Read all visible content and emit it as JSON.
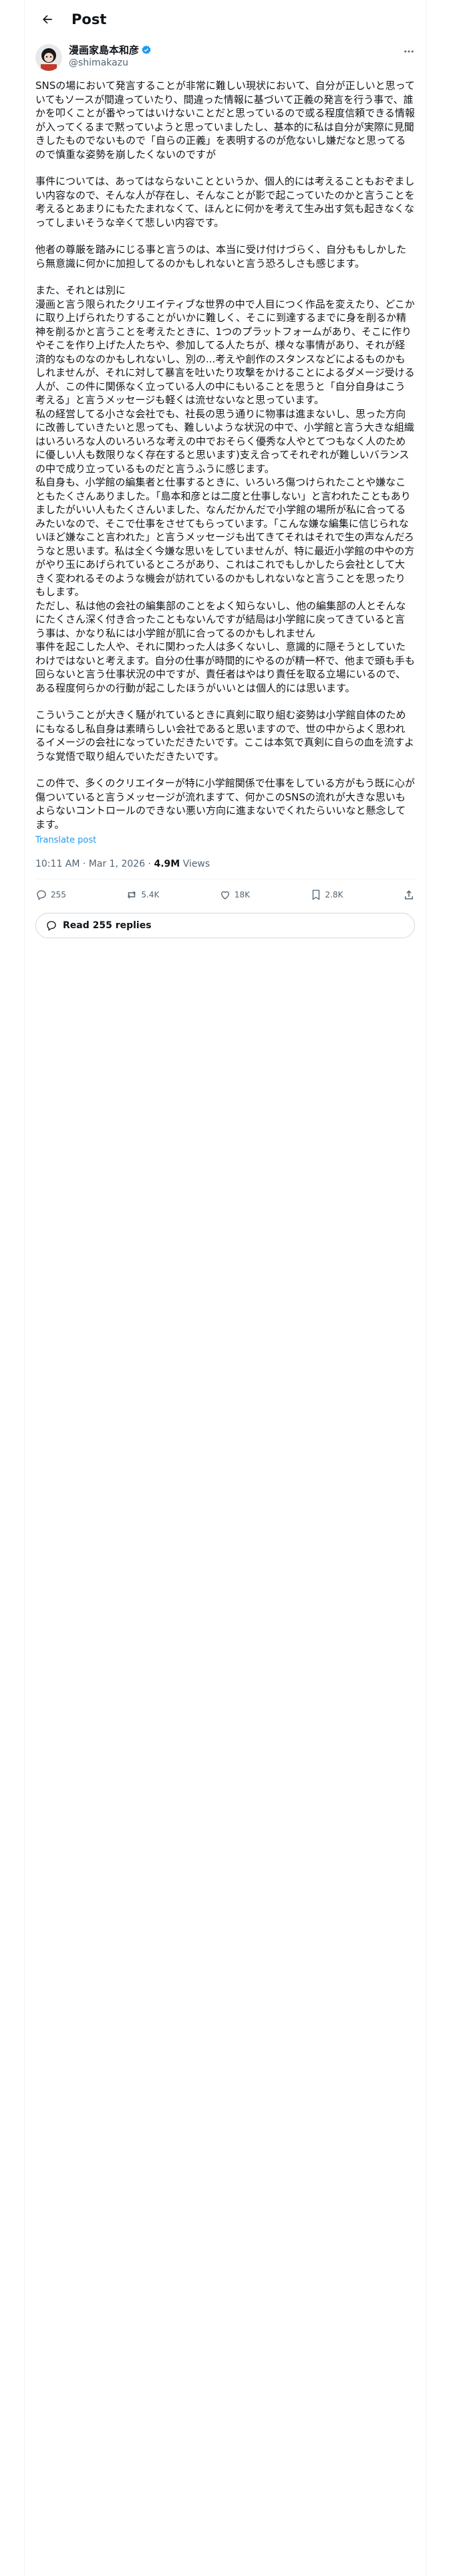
{
  "header": {
    "title": "Post"
  },
  "author": {
    "display_name": "漫画家島本和彦",
    "handle": "@shimakazu"
  },
  "paragraphs": [
    "SNSの場において発言することが非常に難しい現状において、自分が正しいと思っていてもソースが間違っていたり、間違った情報に基づいて正義の発言を行う事で、誰かを叩くことが番やってはいけないことだと思っているので或る程度信頼できる情報が入ってくるまで黙っていようと思っていましたし、基本的に私は自分が実際に見聞きしたものでないもので「自らの正義」を表明するのが危ないし嫌だなと思ってるので慎重な姿勢を崩したくないのですが",
    "事件については、あってはならないことというか、個人的には考えることもおぞましい内容なので、そんな人が存在し、そんなことが影で起こっていたのかと言うことを考えるとあまりにもたたまれなくて、ほんとに何かを考えて生み出す気も起きなくなってしまいそうな辛くて悲しい内容です。",
    "他者の尊厳を踏みにじる事と言うのは、本当に受け付けづらく、自分ももしかしたら無意識に何かに加担してるのかもしれないと言う恐ろしさも感じます。",
    "また、それとは別に\n漫画と言う限られたクリエイティブな世界の中で人目につく作品を変えたり、どこかに取り上げられたりすることがいかに難しく、そこに到達するまでに身を削るか精神を削るかと言うことを考えたときに、1つのプラットフォームがあり、そこに作りやそこを作り上げた人たちや、参加してる人たちが、様々な事情があり、それが経済的なものなのかもしれないし、別の...考えや創作のスタンスなどによるものかもしれませんが、それに対して暴言を吐いたり攻撃をかけることによるダメージ受ける人が、この件に関係なく立っている人の中にもいることを思うと「自分自身はこう考える」と言うメッセージも軽くは流せないなと思っています。",
    "私の経営してる小さな会社でも、社長の思う通りに物事は進まないし、思った方向に改善していきたいと思っても、難しいような状況の中で、小学館と言う大きな組織はいろいろな人のいろいろな考えの中でおそらく優秀な人やとてつもなく人のために優しい人も数限りなく存在すると思います)支え合ってそれぞれが難しいバランスの中で成り立っているものだと言うふうに感じます。",
    "私自身も、小学館の編集者と仕事するときに、いろいろ傷つけられたことや嫌なこともたくさんありました。「島本和彦とは二度と仕事しない」と言われたこともありましたがいい人もたくさんいました、なんだかんだで小学館の場所が私に合ってるみたいなので、そこで仕事をさせてもらっています。「こんな嫌な編集に信じられないほど嫌なこと言われた」と言うメッセージも出てきてそれはそれで生の声なんだろうなと思います。私は全く今嫌な思いをしていませんが、特に最近小学館の中やの方がやり玉にあげられているところがあり、これはこれでもしかしたら会社として大きく変われるそのような機会が訪れているのかもしれないなと言うことを思ったりもします。",
    "ただし、私は他の会社の編集部のことをよく知らないし、他の編集部の人とそんなにたくさん深く付き合ったこともないんですが結局は小学館に戻ってきていると言う事は、かなり私には小学館が肌に合ってるのかもしれません",
    "事件を起こした人や、それに関わった人は多くないし、意識的に隠そうとしていたわけではないと考えます。自分の仕事が時間的にやるのが精一杯で、他まで頭も手も回らないと言う仕事状況の中ですが、責任者はやはり責任を取る立場にいるので、ある程度何らかの行動が起こしたほうがいいとは個人的には思います。",
    "こういうことが大きく騒がれているときに真剣に取り組む姿勢は小学館自体のためにもなるし私自身は素晴らしい会社であると思いますので、世の中からよく思われるイメージの会社になっていただきたいです。ここは本気で真剣に自らの血を流すような覚悟で取り組んでいただきたいです。",
    "この件で、多くのクリエイターが特に小学館関係で仕事をしている方がもう既に心が傷ついていると言うメッセージが流れますて、何かこのSNSの流れが大きな思いもよらないコントロールのできない悪い方向に進まないでくれたらいいなと懸念してます。"
  ],
  "translate_link": "Translate post",
  "meta": {
    "time": "10:11 AM · Mar 1, 2026 · ",
    "views_count": "4.9M",
    "views_label": " Views"
  },
  "actions": {
    "replies": "255",
    "reposts": "5.4K",
    "likes": "18K",
    "bookmarks": "2.8K"
  },
  "read_replies": "Read 255 replies",
  "colors": {
    "accent": "#1d9bf0",
    "verified": "#1d9bf0",
    "muted": "#536471",
    "border": "#eff3f4"
  }
}
